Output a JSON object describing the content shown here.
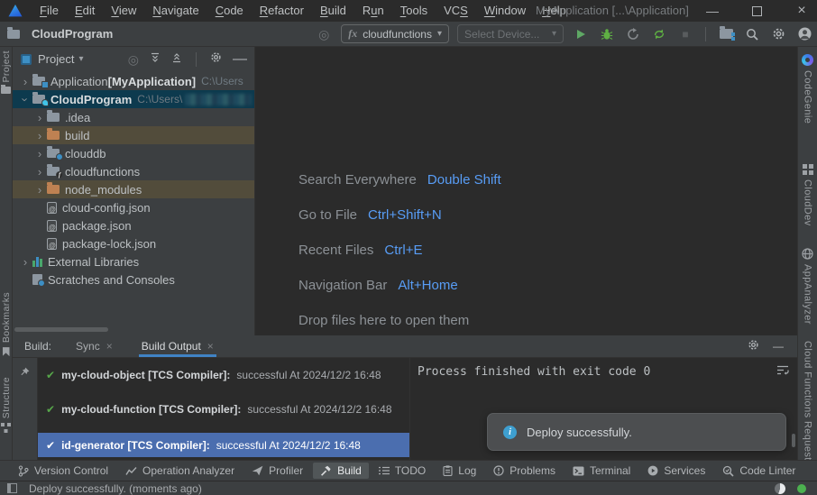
{
  "colors": {
    "accent_blue": "#589df6",
    "selection_blue": "#4b6eaf",
    "tree_selection": "#0d3a4e",
    "excluded_row": "#524c3b",
    "success_green": "#57a64a",
    "tab_underline": "#4083c4",
    "info_blue": "#3e9fd0"
  },
  "icons": {
    "checkmark": "✔",
    "chevron": "›",
    "caret_down": "▾",
    "locate": "◎",
    "minimize": "—",
    "close": "×",
    "tab_close": "×",
    "stop": "■",
    "info": "i"
  },
  "title_bar": {
    "menus": [
      {
        "label": "File",
        "accel": 0
      },
      {
        "label": "Edit",
        "accel": 0
      },
      {
        "label": "View",
        "accel": 0
      },
      {
        "label": "Navigate",
        "accel": 0
      },
      {
        "label": "Code",
        "accel": 0
      },
      {
        "label": "Refactor",
        "accel": 0
      },
      {
        "label": "Build",
        "accel": 0
      },
      {
        "label": "Run",
        "accel": 1
      },
      {
        "label": "Tools",
        "accel": 0
      },
      {
        "label": "VCS",
        "accel": 2
      },
      {
        "label": "Window",
        "accel": 0
      },
      {
        "label": "Help",
        "accel": 0
      }
    ],
    "title": "MyApplication [...\\Application]"
  },
  "toolbar": {
    "project": "CloudProgram",
    "run_config_prefix": "fx",
    "run_config": "cloudfunctions",
    "device_placeholder": "Select Device..."
  },
  "left_stripe": {
    "items": [
      {
        "label": "Project",
        "icon": "project-folder"
      },
      {
        "label": "Bookmarks",
        "icon": "bookmark"
      },
      {
        "label": "Structure",
        "icon": "structure"
      }
    ]
  },
  "right_stripe": {
    "items": [
      {
        "label": "CodeGenie",
        "icon": "codegenie"
      },
      {
        "label": "CloudDev",
        "icon": "clouddev"
      },
      {
        "label": "AppAnalyzer",
        "icon": "appanalyzer"
      },
      {
        "label": "Cloud Functions Requestor",
        "icon": null
      }
    ]
  },
  "project_panel": {
    "title": "Project",
    "tree": [
      {
        "level": 0,
        "chevron": "closed",
        "icon": "folder-module",
        "text": "Application ",
        "bold": "[MyApplication]",
        "path": "C:\\Users"
      },
      {
        "level": 0,
        "chevron": "open",
        "icon": "folder-cloud",
        "text": "",
        "bold": "CloudProgram",
        "path": "C:\\Users\\",
        "redacted": true,
        "row": "selected"
      },
      {
        "level": 1,
        "chevron": "closed",
        "icon": "folder",
        "text": ".idea"
      },
      {
        "level": 1,
        "chevron": "closed",
        "icon": "folder-excluded",
        "text": "build",
        "row": "excluded"
      },
      {
        "level": 1,
        "chevron": "closed",
        "icon": "folder-db",
        "text": "clouddb"
      },
      {
        "level": 1,
        "chevron": "closed",
        "icon": "folder-fn",
        "text": "cloudfunctions"
      },
      {
        "level": 1,
        "chevron": "closed",
        "icon": "folder-excluded",
        "text": "node_modules",
        "row": "excluded"
      },
      {
        "level": 1,
        "chevron": null,
        "icon": "json",
        "text": "cloud-config.json"
      },
      {
        "level": 1,
        "chevron": null,
        "icon": "json",
        "text": "package.json"
      },
      {
        "level": 1,
        "chevron": null,
        "icon": "json",
        "text": "package-lock.json"
      },
      {
        "level": 0,
        "chevron": "closed",
        "icon": "extlib",
        "text": "External Libraries"
      },
      {
        "level": 0,
        "chevron": null,
        "icon": "scratches",
        "text": "Scratches and Consoles"
      }
    ]
  },
  "editor": {
    "shortcuts": [
      {
        "label": "Search Everywhere",
        "keys": "Double Shift"
      },
      {
        "label": "Go to File",
        "keys": "Ctrl+Shift+N"
      },
      {
        "label": "Recent Files",
        "keys": "Ctrl+E"
      },
      {
        "label": "Navigation Bar",
        "keys": "Alt+Home"
      }
    ],
    "drop_hint": "Drop files here to open them"
  },
  "build_panel": {
    "label": "Build:",
    "tabs": [
      {
        "label": "Sync",
        "active": false
      },
      {
        "label": "Build Output",
        "active": true
      }
    ],
    "results": [
      {
        "title": "my-cloud-object [TCS Compiler]:",
        "status": "successful At 2024/12/2 16:48",
        "selected": false
      },
      {
        "title": "my-cloud-function [TCS Compiler]:",
        "status": "successful At 2024/12/2 16:48",
        "selected": false
      },
      {
        "title": "id-generator [TCS Compiler]:",
        "status": "successful At 2024/12/2 16:48",
        "selected": true
      }
    ],
    "console_text": "Process finished with exit code 0",
    "toast": "Deploy successfully."
  },
  "bottom_bar": {
    "items": [
      {
        "label": "Version Control",
        "icon": "branch",
        "active": false
      },
      {
        "label": "Operation Analyzer",
        "icon": "chart",
        "active": false
      },
      {
        "label": "Profiler",
        "icon": "plane",
        "active": false
      },
      {
        "label": "Build",
        "icon": "hammer",
        "active": true
      },
      {
        "label": "TODO",
        "icon": "todo",
        "active": false
      },
      {
        "label": "Log",
        "icon": "log",
        "active": false
      },
      {
        "label": "Problems",
        "icon": "problems",
        "active": false
      },
      {
        "label": "Terminal",
        "icon": "terminal",
        "active": false
      },
      {
        "label": "Services",
        "icon": "services",
        "active": false
      },
      {
        "label": "Code Linter",
        "icon": "linter",
        "active": false
      }
    ]
  },
  "status_bar": {
    "message": "Deploy successfully. (moments ago)"
  }
}
